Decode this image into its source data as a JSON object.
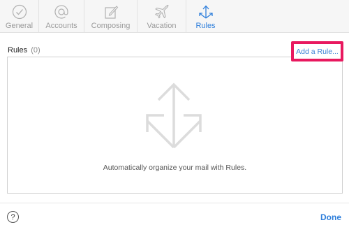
{
  "toolbar": {
    "tabs": [
      {
        "label": "General",
        "icon": "checkmark-circle-icon",
        "active": false
      },
      {
        "label": "Accounts",
        "icon": "at-sign-icon",
        "active": false
      },
      {
        "label": "Composing",
        "icon": "compose-pencil-icon",
        "active": false
      },
      {
        "label": "Vacation",
        "icon": "airplane-icon",
        "active": false
      },
      {
        "label": "Rules",
        "icon": "rules-split-arrows-icon",
        "active": true
      }
    ]
  },
  "rules": {
    "title": "Rules",
    "count": "(0)",
    "add_button": "Add a Rule...",
    "empty_message": "Automatically organize your mail with Rules."
  },
  "footer": {
    "help_label": "?",
    "done_label": "Done"
  },
  "colors": {
    "accent": "#2f7fdb",
    "highlight_border": "#e8195f",
    "tab_inactive": "#9a9a9a"
  }
}
